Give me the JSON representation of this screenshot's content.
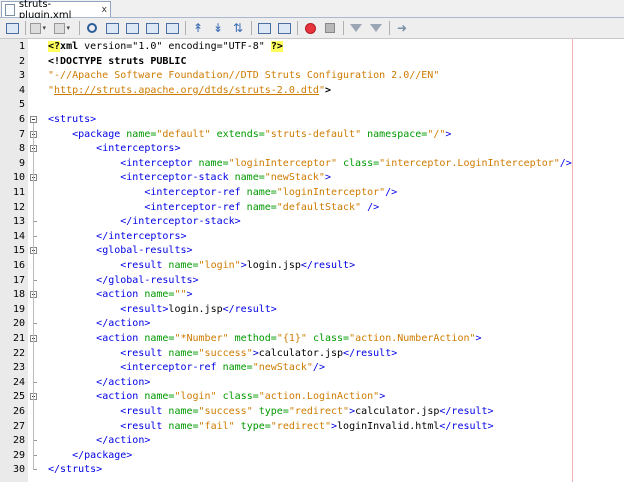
{
  "tab": {
    "filename": "struts-plugin.xml",
    "close": "x"
  },
  "toolbar": {
    "icons": [
      "history-icon",
      "back-icon",
      "forward-icon",
      "find-icon",
      "find-prev-icon",
      "find-next-icon",
      "find-selection-icon",
      "toggle-highlight-icon",
      "toggle-bookmark-icon",
      "prev-bookmark-icon",
      "next-bookmark-icon",
      "shift-left-icon",
      "shift-right-icon",
      "record-macro-icon",
      "stop-macro-icon",
      "prev-error-icon",
      "next-error-icon",
      "validate-xml-icon"
    ]
  },
  "lines": [
    {
      "n": "1",
      "segs": [
        {
          "t": "<?",
          "c": "k hl"
        },
        {
          "t": "xml",
          "c": "k"
        },
        {
          "t": " version=",
          "c": ""
        },
        {
          "t": "\"1.0\"",
          "c": ""
        },
        {
          "t": " encoding=",
          "c": ""
        },
        {
          "t": "\"UTF-8\"",
          "c": ""
        },
        {
          "t": " ",
          "c": ""
        },
        {
          "t": "?>",
          "c": "k hl"
        }
      ]
    },
    {
      "n": "2",
      "segs": [
        {
          "t": "<!DOCTYPE struts PUBLIC",
          "c": "k"
        }
      ]
    },
    {
      "n": "3",
      "segs": [
        {
          "t": "\"-//Apache Software Foundation//DTD Struts Configuration 2.0//EN\"",
          "c": "v"
        }
      ]
    },
    {
      "n": "4",
      "segs": [
        {
          "t": "\"",
          "c": "v"
        },
        {
          "t": "http://struts.apache.org/dtds/struts-2.0.dtd",
          "c": "u"
        },
        {
          "t": "\"",
          "c": "v"
        },
        {
          "t": ">",
          "c": "k"
        }
      ]
    },
    {
      "n": "5",
      "segs": []
    },
    {
      "n": "6",
      "segs": [
        {
          "t": "<struts>",
          "c": "t"
        }
      ]
    },
    {
      "n": "7",
      "segs": [
        {
          "t": "    ",
          "c": ""
        },
        {
          "t": "<package",
          "c": "t"
        },
        {
          "t": " name=",
          "c": "a"
        },
        {
          "t": "\"default\"",
          "c": "v"
        },
        {
          "t": " extends=",
          "c": "a"
        },
        {
          "t": "\"struts-default\"",
          "c": "v"
        },
        {
          "t": " namespace=",
          "c": "a"
        },
        {
          "t": "\"/\"",
          "c": "v"
        },
        {
          "t": ">",
          "c": "t"
        }
      ]
    },
    {
      "n": "8",
      "segs": [
        {
          "t": "        ",
          "c": ""
        },
        {
          "t": "<interceptors>",
          "c": "t"
        }
      ]
    },
    {
      "n": "9",
      "segs": [
        {
          "t": "            ",
          "c": ""
        },
        {
          "t": "<interceptor",
          "c": "t"
        },
        {
          "t": " name=",
          "c": "a"
        },
        {
          "t": "\"loginInterceptor\"",
          "c": "v"
        },
        {
          "t": " class=",
          "c": "a"
        },
        {
          "t": "\"interceptor.LoginInterceptor\"",
          "c": "v"
        },
        {
          "t": "/>",
          "c": "t"
        }
      ]
    },
    {
      "n": "10",
      "segs": [
        {
          "t": "            ",
          "c": ""
        },
        {
          "t": "<interceptor-stack",
          "c": "t"
        },
        {
          "t": " name=",
          "c": "a"
        },
        {
          "t": "\"newStack\"",
          "c": "v"
        },
        {
          "t": ">",
          "c": "t"
        }
      ]
    },
    {
      "n": "11",
      "segs": [
        {
          "t": "                ",
          "c": ""
        },
        {
          "t": "<interceptor-ref",
          "c": "t"
        },
        {
          "t": " name=",
          "c": "a"
        },
        {
          "t": "\"loginInterceptor\"",
          "c": "v"
        },
        {
          "t": "/>",
          "c": "t"
        }
      ]
    },
    {
      "n": "12",
      "segs": [
        {
          "t": "                ",
          "c": ""
        },
        {
          "t": "<interceptor-ref",
          "c": "t"
        },
        {
          "t": " name=",
          "c": "a"
        },
        {
          "t": "\"defaultStack\"",
          "c": "v"
        },
        {
          "t": " />",
          "c": "t"
        }
      ]
    },
    {
      "n": "13",
      "segs": [
        {
          "t": "            ",
          "c": ""
        },
        {
          "t": "</interceptor-stack>",
          "c": "t"
        }
      ]
    },
    {
      "n": "14",
      "segs": [
        {
          "t": "        ",
          "c": ""
        },
        {
          "t": "</interceptors>",
          "c": "t"
        }
      ]
    },
    {
      "n": "15",
      "segs": [
        {
          "t": "        ",
          "c": ""
        },
        {
          "t": "<global-results>",
          "c": "t"
        }
      ]
    },
    {
      "n": "16",
      "segs": [
        {
          "t": "            ",
          "c": ""
        },
        {
          "t": "<result",
          "c": "t"
        },
        {
          "t": " name=",
          "c": "a"
        },
        {
          "t": "\"login\"",
          "c": "v"
        },
        {
          "t": ">",
          "c": "t"
        },
        {
          "t": "login.jsp",
          "c": ""
        },
        {
          "t": "</result>",
          "c": "t"
        }
      ]
    },
    {
      "n": "17",
      "segs": [
        {
          "t": "        ",
          "c": ""
        },
        {
          "t": "</global-results>",
          "c": "t"
        }
      ]
    },
    {
      "n": "18",
      "segs": [
        {
          "t": "        ",
          "c": ""
        },
        {
          "t": "<action",
          "c": "t"
        },
        {
          "t": " name=",
          "c": "a"
        },
        {
          "t": "\"\"",
          "c": "v"
        },
        {
          "t": ">",
          "c": "t"
        }
      ]
    },
    {
      "n": "19",
      "segs": [
        {
          "t": "            ",
          "c": ""
        },
        {
          "t": "<result>",
          "c": "t"
        },
        {
          "t": "login.jsp",
          "c": ""
        },
        {
          "t": "</result>",
          "c": "t"
        }
      ]
    },
    {
      "n": "20",
      "segs": [
        {
          "t": "        ",
          "c": ""
        },
        {
          "t": "</action>",
          "c": "t"
        }
      ]
    },
    {
      "n": "21",
      "segs": [
        {
          "t": "        ",
          "c": ""
        },
        {
          "t": "<action",
          "c": "t"
        },
        {
          "t": " name=",
          "c": "a"
        },
        {
          "t": "\"*Number\"",
          "c": "v"
        },
        {
          "t": " method=",
          "c": "a"
        },
        {
          "t": "\"{1}\"",
          "c": "v"
        },
        {
          "t": " class=",
          "c": "a"
        },
        {
          "t": "\"action.NumberAction\"",
          "c": "v"
        },
        {
          "t": ">",
          "c": "t"
        }
      ]
    },
    {
      "n": "22",
      "segs": [
        {
          "t": "            ",
          "c": ""
        },
        {
          "t": "<result",
          "c": "t"
        },
        {
          "t": " name=",
          "c": "a"
        },
        {
          "t": "\"success\"",
          "c": "v"
        },
        {
          "t": ">",
          "c": "t"
        },
        {
          "t": "calculator.jsp",
          "c": ""
        },
        {
          "t": "</result>",
          "c": "t"
        }
      ]
    },
    {
      "n": "23",
      "segs": [
        {
          "t": "            ",
          "c": ""
        },
        {
          "t": "<interceptor-ref",
          "c": "t"
        },
        {
          "t": " name=",
          "c": "a"
        },
        {
          "t": "\"newStack\"",
          "c": "v"
        },
        {
          "t": "/>",
          "c": "t"
        }
      ]
    },
    {
      "n": "24",
      "segs": [
        {
          "t": "        ",
          "c": ""
        },
        {
          "t": "</action>",
          "c": "t"
        }
      ]
    },
    {
      "n": "25",
      "segs": [
        {
          "t": "        ",
          "c": ""
        },
        {
          "t": "<action",
          "c": "t"
        },
        {
          "t": " name=",
          "c": "a"
        },
        {
          "t": "\"login\"",
          "c": "v"
        },
        {
          "t": " class=",
          "c": "a"
        },
        {
          "t": "\"action.LoginAction\"",
          "c": "v"
        },
        {
          "t": ">",
          "c": "t"
        }
      ]
    },
    {
      "n": "26",
      "segs": [
        {
          "t": "            ",
          "c": ""
        },
        {
          "t": "<result",
          "c": "t"
        },
        {
          "t": " name=",
          "c": "a"
        },
        {
          "t": "\"success\"",
          "c": "v"
        },
        {
          "t": " type=",
          "c": "a"
        },
        {
          "t": "\"redirect\"",
          "c": "v"
        },
        {
          "t": ">",
          "c": "t"
        },
        {
          "t": "calculator.jsp",
          "c": ""
        },
        {
          "t": "</result>",
          "c": "t"
        }
      ]
    },
    {
      "n": "27",
      "segs": [
        {
          "t": "            ",
          "c": ""
        },
        {
          "t": "<result",
          "c": "t"
        },
        {
          "t": " name=",
          "c": "a"
        },
        {
          "t": "\"fail\"",
          "c": "v"
        },
        {
          "t": " type=",
          "c": "a"
        },
        {
          "t": "\"redirect\"",
          "c": "v"
        },
        {
          "t": ">",
          "c": "t"
        },
        {
          "t": "loginInvalid.html",
          "c": ""
        },
        {
          "t": "</result>",
          "c": "t"
        }
      ]
    },
    {
      "n": "28",
      "segs": [
        {
          "t": "        ",
          "c": ""
        },
        {
          "t": "</action>",
          "c": "t"
        }
      ]
    },
    {
      "n": "29",
      "segs": [
        {
          "t": "    ",
          "c": ""
        },
        {
          "t": "</package>",
          "c": "t"
        }
      ]
    },
    {
      "n": "30",
      "segs": [
        {
          "t": "</struts>",
          "c": "t"
        }
      ]
    }
  ]
}
